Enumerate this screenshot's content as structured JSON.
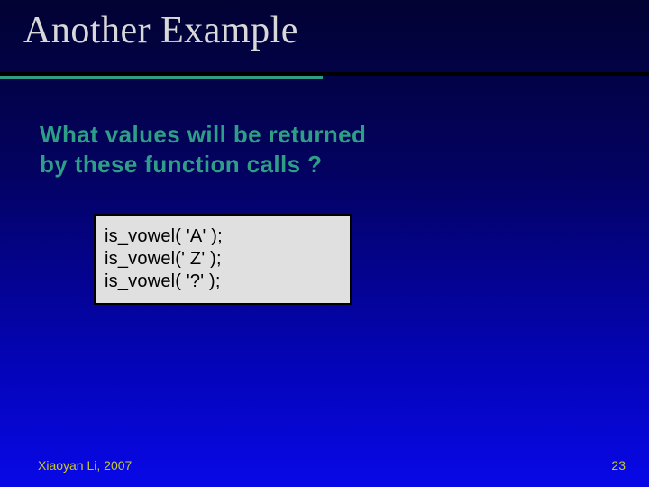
{
  "title": "Another Example",
  "question_line1": "What values will be returned",
  "question_line2": "by these function calls ?",
  "code": {
    "line1": "is_vowel( 'A' );",
    "line2": "is_vowel(' Z' );",
    "line3": "is_vowel( '?' );"
  },
  "footer": {
    "author": "Xiaoyan Li, 2007",
    "page": "23"
  }
}
